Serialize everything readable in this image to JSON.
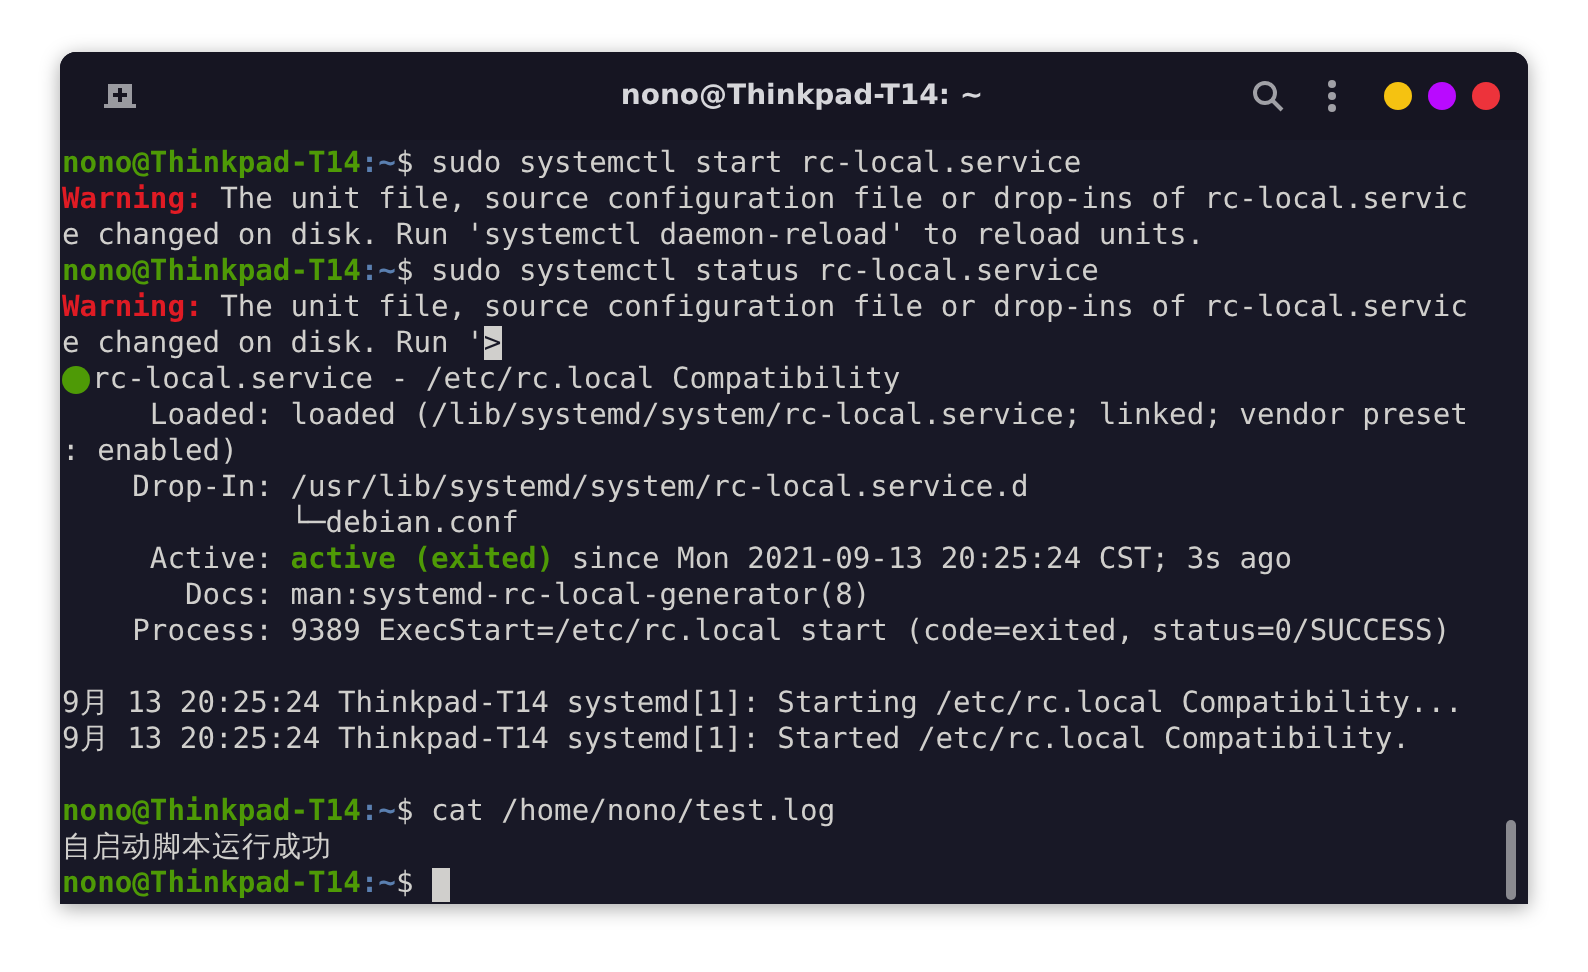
{
  "window": {
    "title": "nono@Thinkpad-T14: ~"
  },
  "lines": [
    {
      "segments": [
        {
          "kind": "user",
          "text": "nono@Thinkpad-T14"
        },
        {
          "kind": "path",
          "text": ":~"
        },
        {
          "kind": "text",
          "text": "$ sudo systemctl start rc-local.service"
        }
      ]
    },
    {
      "segments": [
        {
          "kind": "warning",
          "text": "Warning:"
        },
        {
          "kind": "text",
          "text": " The unit file, source configuration file or drop-ins of rc-local.servic"
        }
      ]
    },
    {
      "segments": [
        {
          "kind": "text",
          "text": "e changed on disk. Run 'systemctl daemon-reload' to reload units."
        }
      ]
    },
    {
      "segments": [
        {
          "kind": "user",
          "text": "nono@Thinkpad-T14"
        },
        {
          "kind": "path",
          "text": ":~"
        },
        {
          "kind": "text",
          "text": "$ sudo systemctl status rc-local.service"
        }
      ]
    },
    {
      "segments": [
        {
          "kind": "warning",
          "text": "Warning:"
        },
        {
          "kind": "text",
          "text": " The unit file, source configuration file or drop-ins of rc-local.servic"
        }
      ]
    },
    {
      "segments": [
        {
          "kind": "text",
          "text": "e changed on disk. Run '"
        },
        {
          "kind": "pager",
          "text": ">"
        }
      ]
    },
    {
      "dot": true,
      "segments": [
        {
          "kind": "text",
          "text": "rc-local.service - /etc/rc.local Compatibility"
        }
      ]
    },
    {
      "segments": [
        {
          "kind": "text",
          "text": "     Loaded: loaded (/lib/systemd/system/rc-local.service; linked; vendor preset"
        }
      ]
    },
    {
      "segments": [
        {
          "kind": "text",
          "text": ": enabled)"
        }
      ]
    },
    {
      "segments": [
        {
          "kind": "text",
          "text": "    Drop-In: /usr/lib/systemd/system/rc-local.service.d"
        }
      ]
    },
    {
      "segments": [
        {
          "kind": "text",
          "text": "             └─debian.conf"
        }
      ]
    },
    {
      "segments": [
        {
          "kind": "text",
          "text": "     Active: "
        },
        {
          "kind": "active",
          "text": "active (exited)"
        },
        {
          "kind": "text",
          "text": " since Mon 2021-09-13 20:25:24 CST; 3s ago"
        }
      ]
    },
    {
      "segments": [
        {
          "kind": "text",
          "text": "       Docs: man:systemd-rc-local-generator(8)"
        }
      ]
    },
    {
      "segments": [
        {
          "kind": "text",
          "text": "    Process: 9389 ExecStart=/etc/rc.local start (code=exited, status=0/SUCCESS)"
        }
      ]
    },
    {
      "kind": "blank"
    },
    {
      "segments": [
        {
          "kind": "text",
          "text": "9月 13 20:25:24 Thinkpad-T14 systemd[1]: Starting /etc/rc.local Compatibility..."
        }
      ]
    },
    {
      "segments": [
        {
          "kind": "text",
          "text": "9月 13 20:25:24 Thinkpad-T14 systemd[1]: Started /etc/rc.local Compatibility."
        }
      ]
    },
    {
      "kind": "blank"
    },
    {
      "segments": [
        {
          "kind": "user",
          "text": "nono@Thinkpad-T14"
        },
        {
          "kind": "path",
          "text": ":~"
        },
        {
          "kind": "text",
          "text": "$ cat /home/nono/test.log"
        }
      ]
    },
    {
      "segments": [
        {
          "kind": "text",
          "text": "自启动脚本运行成功"
        }
      ]
    },
    {
      "cursor": true,
      "segments": [
        {
          "kind": "user",
          "text": "nono@Thinkpad-T14"
        },
        {
          "kind": "path",
          "text": ":~"
        },
        {
          "kind": "text",
          "text": "$ "
        }
      ]
    }
  ]
}
